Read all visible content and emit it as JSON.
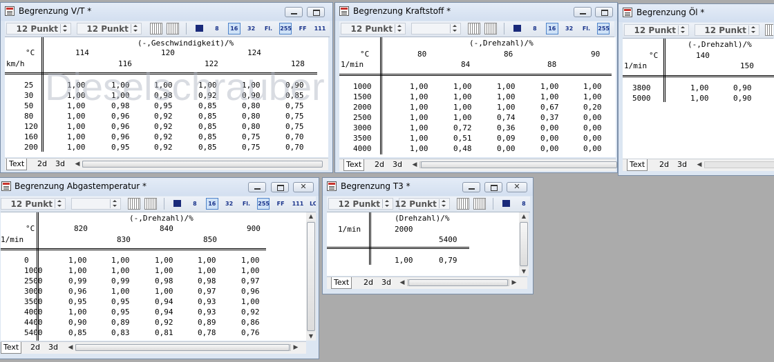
{
  "watermark": "Dieselschrauber",
  "windows": {
    "vt": {
      "title": "Begrenzung V/T *",
      "fonts": [
        "12 Punkt",
        "12 Punkt"
      ],
      "header": "(-,Geschwindigkeit)/%",
      "unit": "°C",
      "axis_unit": "km/h",
      "cols_top": [
        "114",
        "120",
        "124"
      ],
      "cols_bottom": [
        "116",
        "122",
        "128"
      ],
      "rows": [
        {
          "k": "25",
          "v": [
            "1,00",
            "1,00",
            "1,00",
            "1,00",
            "1,00",
            "0,90"
          ]
        },
        {
          "k": "30",
          "v": [
            "1,00",
            "1,00",
            "0,98",
            "0,92",
            "0,90",
            "0,85"
          ]
        },
        {
          "k": "50",
          "v": [
            "1,00",
            "0,98",
            "0,95",
            "0,85",
            "0,80",
            "0,75"
          ]
        },
        {
          "k": "80",
          "v": [
            "1,00",
            "0,96",
            "0,92",
            "0,85",
            "0,80",
            "0,75"
          ]
        },
        {
          "k": "120",
          "v": [
            "1,00",
            "0,96",
            "0,92",
            "0,85",
            "0,80",
            "0,75"
          ]
        },
        {
          "k": "160",
          "v": [
            "1,00",
            "0,96",
            "0,92",
            "0,85",
            "0,75",
            "0,70"
          ]
        },
        {
          "k": "200",
          "v": [
            "1,00",
            "0,95",
            "0,92",
            "0,85",
            "0,75",
            "0,70"
          ]
        }
      ],
      "tabs": [
        "Text",
        "2d",
        "3d"
      ]
    },
    "kraftstoff": {
      "title": "Begrenzung Kraftstoff *",
      "fonts": [
        "12 Punkt"
      ],
      "header": "(-,Drehzahl)/%",
      "unit": "°C",
      "axis_unit": "1/min",
      "cols_top": [
        "80",
        "86",
        "90"
      ],
      "cols_bottom": [
        "84",
        "88"
      ],
      "rows": [
        {
          "k": "1000",
          "v": [
            "1,00",
            "1,00",
            "1,00",
            "1,00",
            "1,00"
          ]
        },
        {
          "k": "1500",
          "v": [
            "1,00",
            "1,00",
            "1,00",
            "1,00",
            "1,00"
          ]
        },
        {
          "k": "2000",
          "v": [
            "1,00",
            "1,00",
            "1,00",
            "0,67",
            "0,20"
          ]
        },
        {
          "k": "2500",
          "v": [
            "1,00",
            "1,00",
            "0,74",
            "0,37",
            "0,00"
          ]
        },
        {
          "k": "3000",
          "v": [
            "1,00",
            "0,72",
            "0,36",
            "0,00",
            "0,00"
          ]
        },
        {
          "k": "3500",
          "v": [
            "1,00",
            "0,51",
            "0,09",
            "0,00",
            "0,00"
          ]
        },
        {
          "k": "4000",
          "v": [
            "1,00",
            "0,48",
            "0,00",
            "0,00",
            "0,00"
          ]
        }
      ],
      "tabs": [
        "Text",
        "2d",
        "3d"
      ]
    },
    "oel": {
      "title": "Begrenzung Öl *",
      "fonts": [
        "12 Punkt",
        "12 Punkt"
      ],
      "header": "(-,Drehzahl)/%",
      "unit": "°C",
      "axis_unit": "1/min",
      "cols_top": [
        "140"
      ],
      "cols_bottom": [
        "150"
      ],
      "rows": [
        {
          "k": "3800",
          "v": [
            "1,00",
            "0,90"
          ]
        },
        {
          "k": "5000",
          "v": [
            "1,00",
            "0,90"
          ]
        }
      ],
      "tabs": [
        "Text",
        "2d",
        "3d"
      ]
    },
    "abgas": {
      "title": "Begrenzung Abgastemperatur *",
      "fonts": [
        "12 Punkt"
      ],
      "header": "(-,Drehzahl)/%",
      "unit": "°C",
      "axis_unit": "1/min",
      "cols_top": [
        "820",
        "840",
        "900"
      ],
      "cols_bottom": [
        "830",
        "850"
      ],
      "rows": [
        {
          "k": "0",
          "v": [
            "1,00",
            "1,00",
            "1,00",
            "1,00",
            "1,00"
          ]
        },
        {
          "k": "1000",
          "v": [
            "1,00",
            "1,00",
            "1,00",
            "1,00",
            "1,00"
          ]
        },
        {
          "k": "2500",
          "v": [
            "0,99",
            "0,99",
            "0,98",
            "0,98",
            "0,97"
          ]
        },
        {
          "k": "3000",
          "v": [
            "0,96",
            "1,00",
            "1,00",
            "0,97",
            "0,96"
          ]
        },
        {
          "k": "3500",
          "v": [
            "0,95",
            "0,95",
            "0,94",
            "0,93",
            "1,00"
          ]
        },
        {
          "k": "4000",
          "v": [
            "1,00",
            "0,95",
            "0,94",
            "0,93",
            "0,92"
          ]
        },
        {
          "k": "4400",
          "v": [
            "0,90",
            "0,89",
            "0,92",
            "0,89",
            "0,86"
          ]
        },
        {
          "k": "5400",
          "v": [
            "0,85",
            "0,83",
            "0,81",
            "0,78",
            "0,76"
          ]
        }
      ],
      "tabs": [
        "Text",
        "2d",
        "3d"
      ]
    },
    "t3": {
      "title": "Begrenzung T3 *",
      "fonts": [
        "12 Punkt",
        "12 Punkt"
      ],
      "header": "(Drehzahl)/%",
      "axis_unit": "1/min",
      "cols_top": [
        "2000"
      ],
      "cols_bottom": [
        "5400"
      ],
      "rows": [
        {
          "k": "",
          "v": [
            "1,00",
            "0,79"
          ]
        }
      ],
      "tabs": [
        "Text",
        "2d",
        "3d"
      ]
    }
  },
  "toolbar_labels": {
    "bits8": "8",
    "bits16": "16",
    "bits32": "32",
    "float": "Fl.",
    "b255": "255",
    "ff": "FF",
    "b111": "111",
    "lohi": "LOHI"
  }
}
